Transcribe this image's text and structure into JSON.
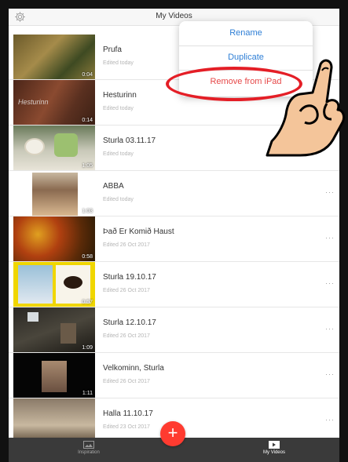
{
  "header": {
    "title": "My Videos",
    "settings_icon": "gear-icon"
  },
  "menu": {
    "rename": "Rename",
    "duplicate": "Duplicate",
    "remove": "Remove from iPad"
  },
  "videos": [
    {
      "title": "Prufa",
      "date": "Edited today",
      "duration": "0:04",
      "thumb_caption": ""
    },
    {
      "title": "Hesturinn",
      "date": "Edited today",
      "duration": "0:14",
      "thumb_caption": "Hesturinn"
    },
    {
      "title": "Sturla 03.11.17",
      "date": "Edited today",
      "duration": "1:05",
      "thumb_caption": ""
    },
    {
      "title": "ABBA",
      "date": "Edited today",
      "duration": "1:03",
      "thumb_caption": ""
    },
    {
      "title": "Það Er Komið Haust",
      "date": "Edited 26 Oct 2017",
      "duration": "0:58",
      "thumb_caption": ""
    },
    {
      "title": "Sturla 19.10.17",
      "date": "Edited 26 Oct 2017",
      "duration": "0:57",
      "thumb_caption": ""
    },
    {
      "title": "Sturla 12.10.17",
      "date": "Edited 26 Oct 2017",
      "duration": "1:09",
      "thumb_caption": ""
    },
    {
      "title": "Velkominn, Sturla",
      "date": "Edited 26 Oct 2017",
      "duration": "1:11",
      "thumb_caption": ""
    },
    {
      "title": "Halla 11.10.17",
      "date": "Edited 23 Oct 2017",
      "duration": "",
      "thumb_caption": ""
    }
  ],
  "more_label": "···",
  "tabbar": {
    "inspiration": "Inspiration",
    "my_videos": "My Videos",
    "add_label": "+"
  },
  "colors": {
    "accent": "#2f7fd6",
    "destructive": "#e64848",
    "add_button": "#ff3b30",
    "highlight": "#e41e26"
  }
}
